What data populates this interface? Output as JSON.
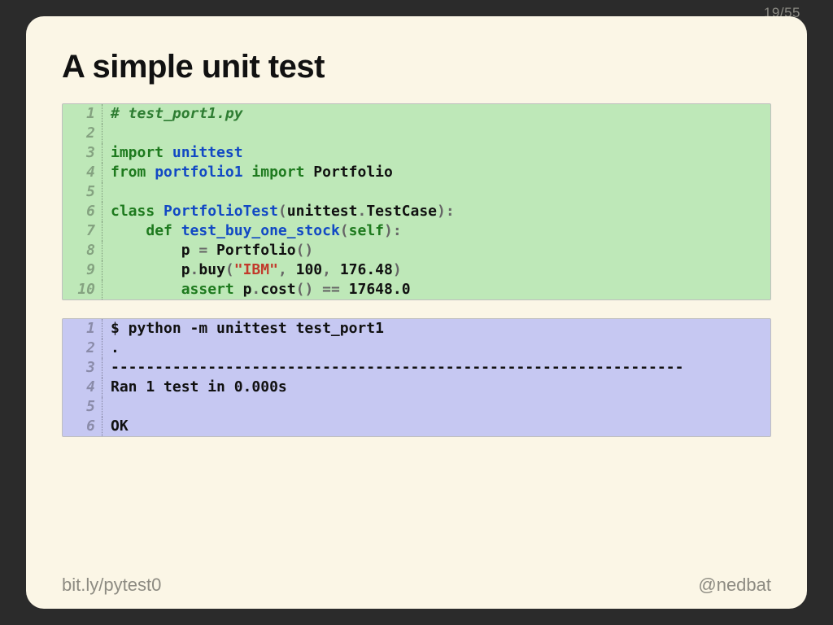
{
  "page": {
    "current": 19,
    "total": 55
  },
  "title": "A simple unit test",
  "code_block_1": {
    "style": "green",
    "lines": [
      [
        {
          "t": "# test_port1.py",
          "c": "comment"
        }
      ],
      [],
      [
        {
          "t": "import",
          "c": "keyword"
        },
        {
          "t": " ",
          "c": "text"
        },
        {
          "t": "unittest",
          "c": "name"
        }
      ],
      [
        {
          "t": "from",
          "c": "keyword"
        },
        {
          "t": " ",
          "c": "text"
        },
        {
          "t": "portfolio1",
          "c": "name"
        },
        {
          "t": " ",
          "c": "text"
        },
        {
          "t": "import",
          "c": "keyword"
        },
        {
          "t": " ",
          "c": "text"
        },
        {
          "t": "Portfolio",
          "c": "text"
        }
      ],
      [],
      [
        {
          "t": "class",
          "c": "keyword"
        },
        {
          "t": " ",
          "c": "text"
        },
        {
          "t": "PortfolioTest",
          "c": "name"
        },
        {
          "t": "(",
          "c": "punct"
        },
        {
          "t": "unittest",
          "c": "text"
        },
        {
          "t": ".",
          "c": "punct"
        },
        {
          "t": "TestCase",
          "c": "text"
        },
        {
          "t": "):",
          "c": "punct"
        }
      ],
      [
        {
          "t": "    ",
          "c": "text"
        },
        {
          "t": "def",
          "c": "keyword"
        },
        {
          "t": " ",
          "c": "text"
        },
        {
          "t": "test_buy_one_stock",
          "c": "name"
        },
        {
          "t": "(",
          "c": "punct"
        },
        {
          "t": "self",
          "c": "keyword"
        },
        {
          "t": "):",
          "c": "punct"
        }
      ],
      [
        {
          "t": "        p ",
          "c": "text"
        },
        {
          "t": "=",
          "c": "punct"
        },
        {
          "t": " Portfolio",
          "c": "text"
        },
        {
          "t": "()",
          "c": "punct"
        }
      ],
      [
        {
          "t": "        p",
          "c": "text"
        },
        {
          "t": ".",
          "c": "punct"
        },
        {
          "t": "buy",
          "c": "text"
        },
        {
          "t": "(",
          "c": "punct"
        },
        {
          "t": "\"IBM\"",
          "c": "string"
        },
        {
          "t": ", ",
          "c": "punct"
        },
        {
          "t": "100",
          "c": "num"
        },
        {
          "t": ", ",
          "c": "punct"
        },
        {
          "t": "176.48",
          "c": "num"
        },
        {
          "t": ")",
          "c": "punct"
        }
      ],
      [
        {
          "t": "        ",
          "c": "text"
        },
        {
          "t": "assert",
          "c": "keyword"
        },
        {
          "t": " p",
          "c": "text"
        },
        {
          "t": ".",
          "c": "punct"
        },
        {
          "t": "cost",
          "c": "text"
        },
        {
          "t": "() ",
          "c": "punct"
        },
        {
          "t": "==",
          "c": "punct"
        },
        {
          "t": " ",
          "c": "text"
        },
        {
          "t": "17648.0",
          "c": "num"
        }
      ]
    ]
  },
  "code_block_2": {
    "style": "purple",
    "lines": [
      [
        {
          "t": "$ python -m unittest test_port1",
          "c": "text"
        }
      ],
      [
        {
          "t": ".",
          "c": "text"
        }
      ],
      [
        {
          "t": "-----------------------------------------------------------------",
          "c": "text"
        }
      ],
      [
        {
          "t": "Ran 1 test in 0.000s",
          "c": "text"
        }
      ],
      [],
      [
        {
          "t": "OK",
          "c": "text"
        }
      ]
    ]
  },
  "footer": {
    "link_host": "bit.ly",
    "link_sep": "/",
    "link_path": "pytest0",
    "handle": "@nedbat"
  }
}
